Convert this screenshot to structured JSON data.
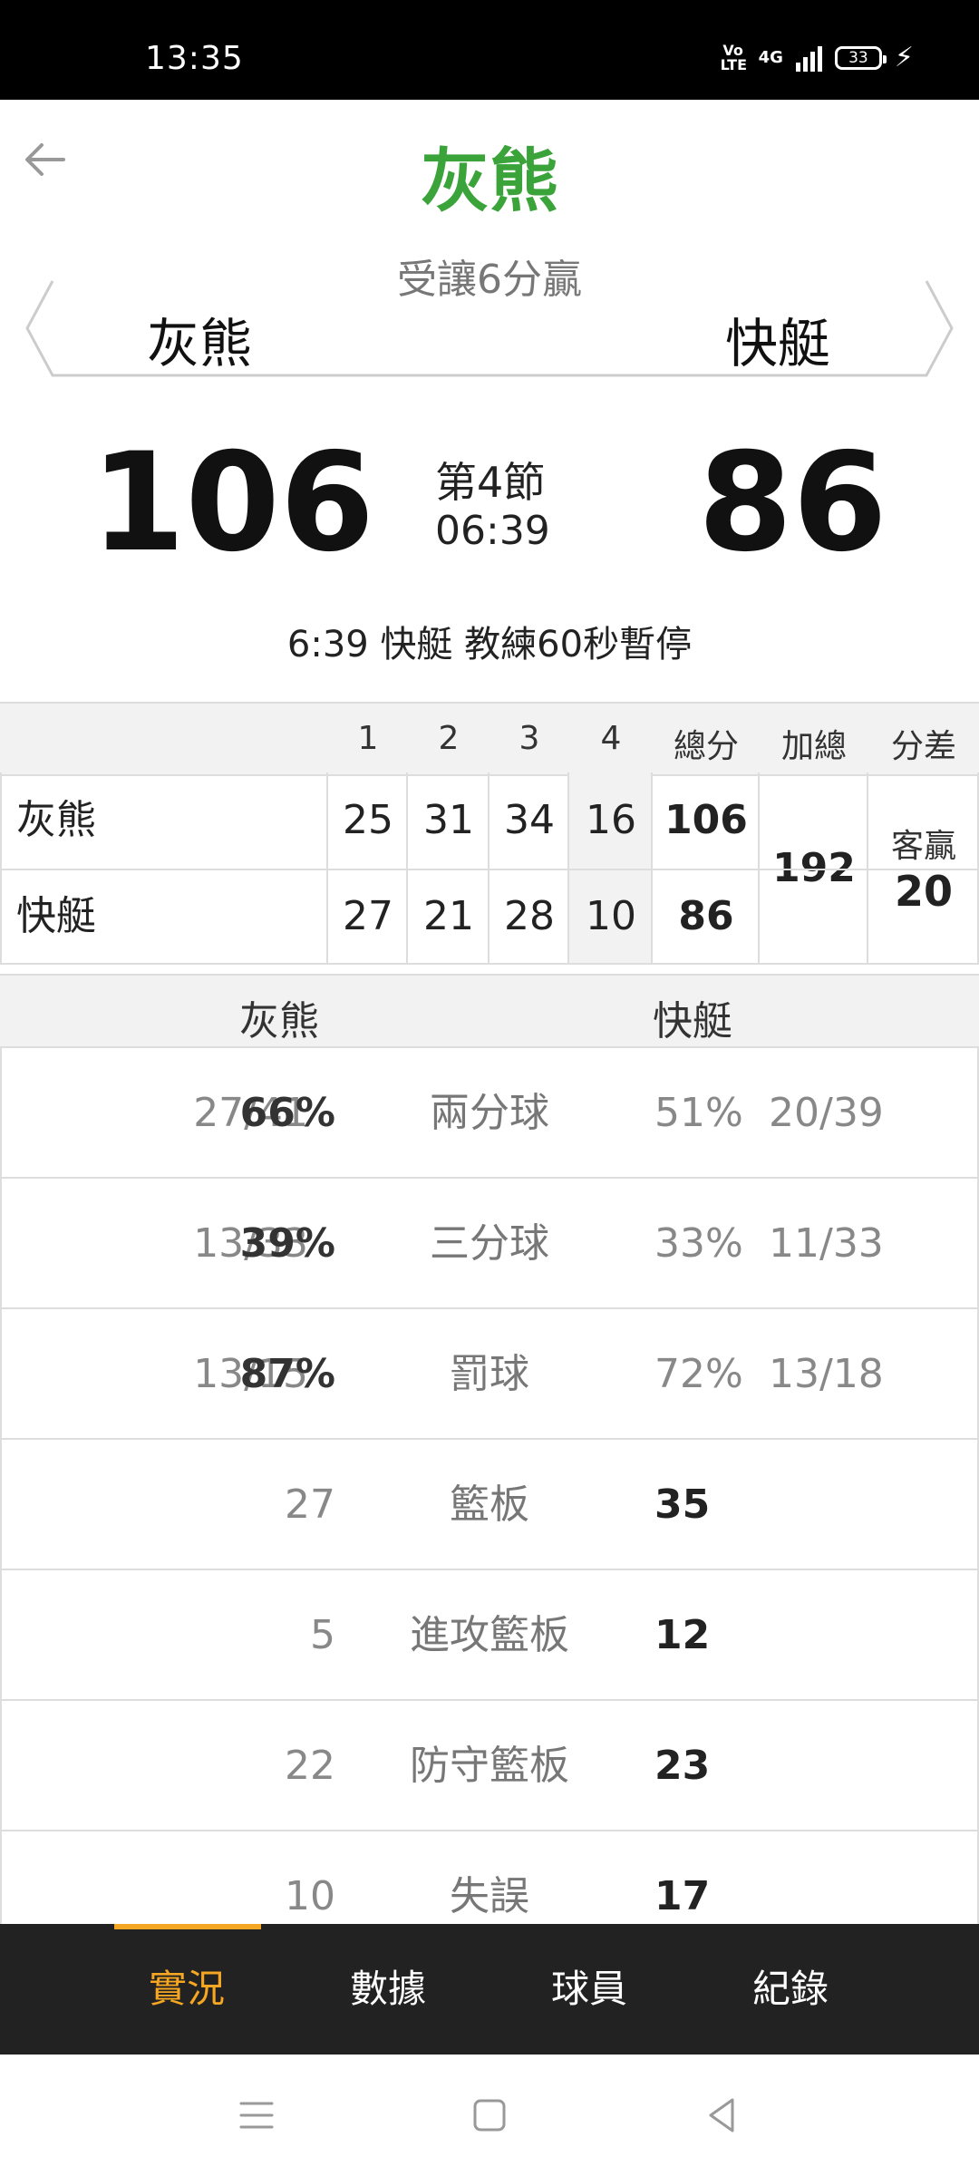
{
  "status": {
    "time": "13:35",
    "volte": "Vo LTE",
    "network": "4G",
    "battery": "33"
  },
  "header": {
    "leader": "灰熊",
    "spread": "受讓6分贏",
    "home_team": "灰熊",
    "away_team": "快艇"
  },
  "score": {
    "home": "106",
    "away": "86",
    "period": "第4節",
    "clock": "06:39",
    "event": "6:39 快艇  教練60秒暫停"
  },
  "boxscore": {
    "headers": [
      "1",
      "2",
      "3",
      "4",
      "總分",
      "加總",
      "分差"
    ],
    "rows": [
      {
        "team": "灰熊",
        "q": [
          "25",
          "31",
          "34",
          "16"
        ],
        "total": "106"
      },
      {
        "team": "快艇",
        "q": [
          "27",
          "21",
          "28",
          "10"
        ],
        "total": "86"
      }
    ],
    "sum": "192",
    "diff_label": "客贏",
    "diff": "20"
  },
  "comparison": {
    "home": "灰熊",
    "away": "快艇",
    "rows": [
      {
        "label": "兩分球",
        "home_frac": "27/41",
        "home_val": "66%",
        "away_val": "51%",
        "away_frac": "20/39"
      },
      {
        "label": "三分球",
        "home_frac": "13/33",
        "home_val": "39%",
        "away_val": "33%",
        "away_frac": "11/33"
      },
      {
        "label": "罰球",
        "home_frac": "13/15",
        "home_val": "87%",
        "away_val": "72%",
        "away_frac": "13/18"
      },
      {
        "label": "籃板",
        "home_frac": "",
        "home_val": "27",
        "away_val": "35",
        "away_frac": ""
      },
      {
        "label": "進攻籃板",
        "home_frac": "",
        "home_val": "5",
        "away_val": "12",
        "away_frac": ""
      },
      {
        "label": "防守籃板",
        "home_frac": "",
        "home_val": "22",
        "away_val": "23",
        "away_frac": ""
      },
      {
        "label": "失誤",
        "home_frac": "",
        "home_val": "10",
        "away_val": "17",
        "away_frac": ""
      }
    ]
  },
  "tabs": [
    "實況",
    "數據",
    "球員",
    "紀錄"
  ],
  "colors": {
    "accent": "#f5a623",
    "leader": "#3aa33a"
  }
}
